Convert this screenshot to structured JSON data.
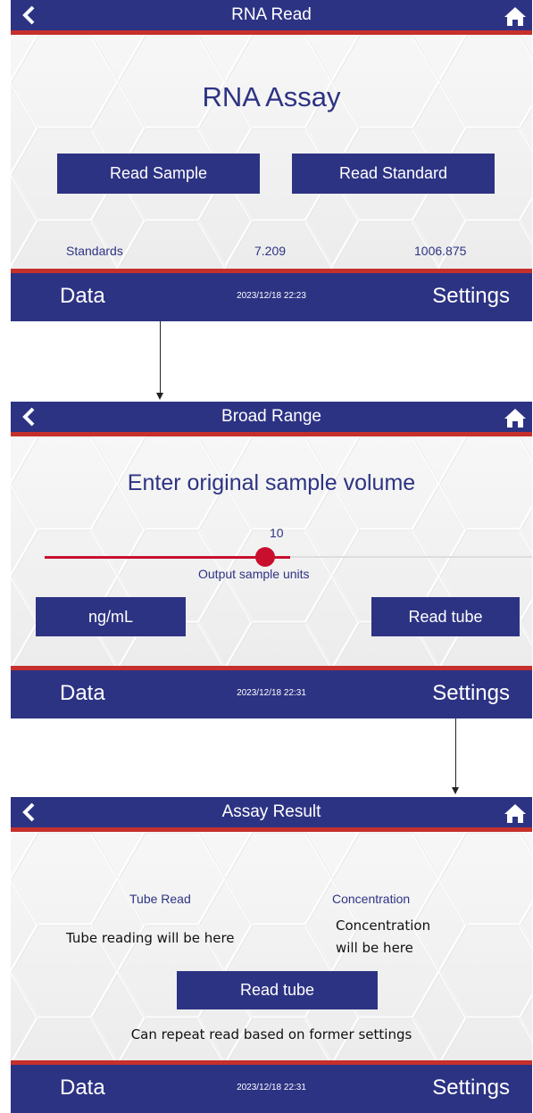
{
  "screens": [
    {
      "title": "RNA Read",
      "heading": "RNA Assay",
      "read_sample_label": "Read Sample",
      "read_standard_label": "Read Standard",
      "standards_label": "Standards",
      "standard_value_1": "7.209",
      "standard_value_2": "1006.875",
      "data_label": "Data",
      "datetime": "2023/12/18   22:23",
      "settings_label": "Settings"
    },
    {
      "title": "Broad Range",
      "heading": "Enter original sample volume",
      "slider_value_label": "10",
      "slider_level": 0.5,
      "output_units_label": "Output sample units",
      "units_button_label": "ng/mL",
      "read_tube_label": "Read tube",
      "data_label": "Data",
      "datetime": "2023/12/18   22:31",
      "settings_label": "Settings"
    },
    {
      "title": "Assay Result",
      "tube_read_label": "Tube Read",
      "concentration_label": "Concentration",
      "tube_reading_placeholder": "Tube reading will be here",
      "concentration_placeholder_line1": "Concentration",
      "concentration_placeholder_line2": "will be here",
      "read_tube_label": "Read tube",
      "repeat_note": "Can repeat read based on former settings",
      "data_label": "Data",
      "datetime": "2023/12/18   22:31",
      "settings_label": "Settings"
    }
  ],
  "colors": {
    "navy": "#2d3383",
    "red_accent": "#c6302c",
    "slider_knob": "#c8102e"
  },
  "icons": [
    "back-chevron-icon",
    "home-icon"
  ]
}
